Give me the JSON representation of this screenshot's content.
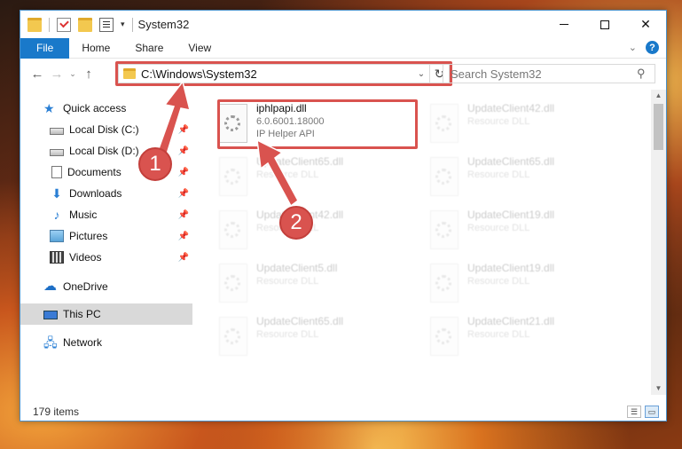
{
  "window": {
    "title": "System32",
    "controls": {
      "minimize": "—",
      "maximize": "☐",
      "close": "✕"
    }
  },
  "ribbon": {
    "tabs": [
      "File",
      "Home",
      "Share",
      "View"
    ]
  },
  "navbar": {
    "back": "←",
    "forward": "→",
    "recent": "⌄",
    "up": "↑",
    "address": "C:\\Windows\\System32",
    "search_placeholder": "Search System32"
  },
  "sidebar": {
    "items": [
      {
        "label": "Quick access",
        "icon": "star-icon"
      },
      {
        "label": "Local Disk (C:)",
        "icon": "drive-icon",
        "pinned": true
      },
      {
        "label": "Local Disk (D:)",
        "icon": "drive-icon",
        "pinned": true
      },
      {
        "label": "Documents",
        "icon": "documents-icon",
        "pinned": true
      },
      {
        "label": "Downloads",
        "icon": "download-icon",
        "pinned": true
      },
      {
        "label": "Music",
        "icon": "music-icon",
        "pinned": true
      },
      {
        "label": "Pictures",
        "icon": "pictures-icon",
        "pinned": true
      },
      {
        "label": "Videos",
        "icon": "videos-icon",
        "pinned": true
      },
      {
        "label": "OneDrive",
        "icon": "cloud-icon"
      },
      {
        "label": "This PC",
        "icon": "pc-icon",
        "selected": true
      },
      {
        "label": "Network",
        "icon": "network-icon"
      }
    ]
  },
  "files": [
    {
      "name": "iphlpapi.dll",
      "line2": "6.0.6001.18000",
      "line3": "IP Helper API"
    },
    {
      "name": "UpdateClient42.dll",
      "line2": "Resource DLL"
    },
    {
      "name": "UpdateClient65.dll",
      "line2": "Resource DLL"
    },
    {
      "name": "UpdateClient65.dll",
      "line2": "Resource DLL"
    },
    {
      "name": "UpdateClient42.dll",
      "line2": "Resource DLL"
    },
    {
      "name": "UpdateClient19.dll",
      "line2": "Resource DLL"
    },
    {
      "name": "UpdateClient5.dll",
      "line2": "Resource DLL"
    },
    {
      "name": "UpdateClient19.dll",
      "line2": "Resource DLL"
    },
    {
      "name": "UpdateClient65.dll",
      "line2": "Resource DLL"
    },
    {
      "name": "UpdateClient21.dll",
      "line2": "Resource DLL"
    }
  ],
  "status": {
    "item_count": "179 items"
  },
  "annotations": {
    "step1": "1",
    "step2": "2",
    "color": "#d9534f"
  }
}
